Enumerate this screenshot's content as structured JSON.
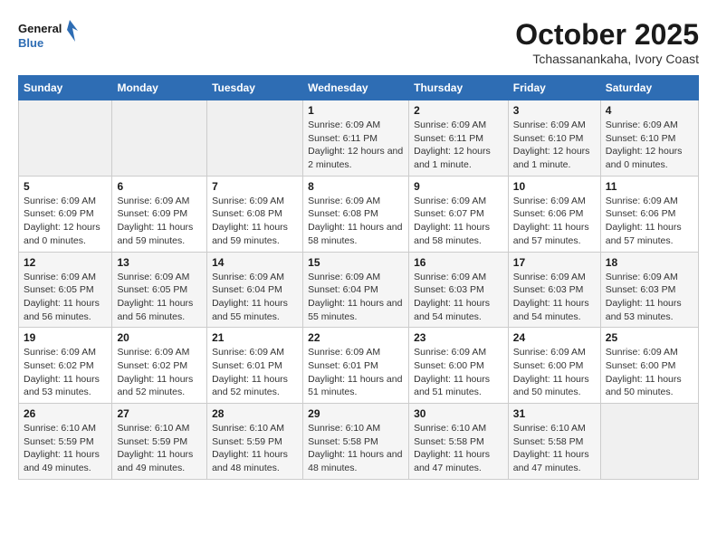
{
  "logo": {
    "line1": "General",
    "line2": "Blue"
  },
  "title": "October 2025",
  "subtitle": "Tchassanankaha, Ivory Coast",
  "days_of_week": [
    "Sunday",
    "Monday",
    "Tuesday",
    "Wednesday",
    "Thursday",
    "Friday",
    "Saturday"
  ],
  "weeks": [
    [
      {
        "day": "",
        "info": ""
      },
      {
        "day": "",
        "info": ""
      },
      {
        "day": "",
        "info": ""
      },
      {
        "day": "1",
        "info": "Sunrise: 6:09 AM\nSunset: 6:11 PM\nDaylight: 12 hours and 2 minutes."
      },
      {
        "day": "2",
        "info": "Sunrise: 6:09 AM\nSunset: 6:11 PM\nDaylight: 12 hours and 1 minute."
      },
      {
        "day": "3",
        "info": "Sunrise: 6:09 AM\nSunset: 6:10 PM\nDaylight: 12 hours and 1 minute."
      },
      {
        "day": "4",
        "info": "Sunrise: 6:09 AM\nSunset: 6:10 PM\nDaylight: 12 hours and 0 minutes."
      }
    ],
    [
      {
        "day": "5",
        "info": "Sunrise: 6:09 AM\nSunset: 6:09 PM\nDaylight: 12 hours and 0 minutes."
      },
      {
        "day": "6",
        "info": "Sunrise: 6:09 AM\nSunset: 6:09 PM\nDaylight: 11 hours and 59 minutes."
      },
      {
        "day": "7",
        "info": "Sunrise: 6:09 AM\nSunset: 6:08 PM\nDaylight: 11 hours and 59 minutes."
      },
      {
        "day": "8",
        "info": "Sunrise: 6:09 AM\nSunset: 6:08 PM\nDaylight: 11 hours and 58 minutes."
      },
      {
        "day": "9",
        "info": "Sunrise: 6:09 AM\nSunset: 6:07 PM\nDaylight: 11 hours and 58 minutes."
      },
      {
        "day": "10",
        "info": "Sunrise: 6:09 AM\nSunset: 6:06 PM\nDaylight: 11 hours and 57 minutes."
      },
      {
        "day": "11",
        "info": "Sunrise: 6:09 AM\nSunset: 6:06 PM\nDaylight: 11 hours and 57 minutes."
      }
    ],
    [
      {
        "day": "12",
        "info": "Sunrise: 6:09 AM\nSunset: 6:05 PM\nDaylight: 11 hours and 56 minutes."
      },
      {
        "day": "13",
        "info": "Sunrise: 6:09 AM\nSunset: 6:05 PM\nDaylight: 11 hours and 56 minutes."
      },
      {
        "day": "14",
        "info": "Sunrise: 6:09 AM\nSunset: 6:04 PM\nDaylight: 11 hours and 55 minutes."
      },
      {
        "day": "15",
        "info": "Sunrise: 6:09 AM\nSunset: 6:04 PM\nDaylight: 11 hours and 55 minutes."
      },
      {
        "day": "16",
        "info": "Sunrise: 6:09 AM\nSunset: 6:03 PM\nDaylight: 11 hours and 54 minutes."
      },
      {
        "day": "17",
        "info": "Sunrise: 6:09 AM\nSunset: 6:03 PM\nDaylight: 11 hours and 54 minutes."
      },
      {
        "day": "18",
        "info": "Sunrise: 6:09 AM\nSunset: 6:03 PM\nDaylight: 11 hours and 53 minutes."
      }
    ],
    [
      {
        "day": "19",
        "info": "Sunrise: 6:09 AM\nSunset: 6:02 PM\nDaylight: 11 hours and 53 minutes."
      },
      {
        "day": "20",
        "info": "Sunrise: 6:09 AM\nSunset: 6:02 PM\nDaylight: 11 hours and 52 minutes."
      },
      {
        "day": "21",
        "info": "Sunrise: 6:09 AM\nSunset: 6:01 PM\nDaylight: 11 hours and 52 minutes."
      },
      {
        "day": "22",
        "info": "Sunrise: 6:09 AM\nSunset: 6:01 PM\nDaylight: 11 hours and 51 minutes."
      },
      {
        "day": "23",
        "info": "Sunrise: 6:09 AM\nSunset: 6:00 PM\nDaylight: 11 hours and 51 minutes."
      },
      {
        "day": "24",
        "info": "Sunrise: 6:09 AM\nSunset: 6:00 PM\nDaylight: 11 hours and 50 minutes."
      },
      {
        "day": "25",
        "info": "Sunrise: 6:09 AM\nSunset: 6:00 PM\nDaylight: 11 hours and 50 minutes."
      }
    ],
    [
      {
        "day": "26",
        "info": "Sunrise: 6:10 AM\nSunset: 5:59 PM\nDaylight: 11 hours and 49 minutes."
      },
      {
        "day": "27",
        "info": "Sunrise: 6:10 AM\nSunset: 5:59 PM\nDaylight: 11 hours and 49 minutes."
      },
      {
        "day": "28",
        "info": "Sunrise: 6:10 AM\nSunset: 5:59 PM\nDaylight: 11 hours and 48 minutes."
      },
      {
        "day": "29",
        "info": "Sunrise: 6:10 AM\nSunset: 5:58 PM\nDaylight: 11 hours and 48 minutes."
      },
      {
        "day": "30",
        "info": "Sunrise: 6:10 AM\nSunset: 5:58 PM\nDaylight: 11 hours and 47 minutes."
      },
      {
        "day": "31",
        "info": "Sunrise: 6:10 AM\nSunset: 5:58 PM\nDaylight: 11 hours and 47 minutes."
      },
      {
        "day": "",
        "info": ""
      }
    ]
  ]
}
